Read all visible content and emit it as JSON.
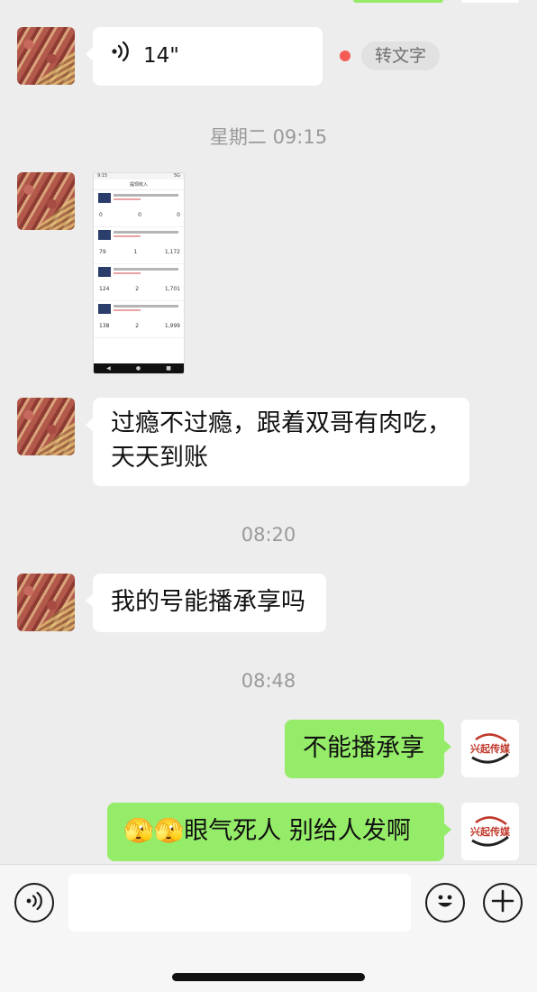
{
  "messages": {
    "voice": {
      "duration": "14\"",
      "convert_label": "转文字"
    },
    "time1": "星期二 09:15",
    "thumbnail": {
      "title": "提现收入",
      "status_left": "9:15",
      "status_right": "5G",
      "rows": [
        {
          "values": [
            "0",
            "0",
            "0"
          ]
        },
        {
          "values": [
            "79",
            "1",
            "1,172"
          ]
        },
        {
          "values": [
            "124",
            "2",
            "1,701"
          ]
        },
        {
          "values": [
            "138",
            "2",
            "1,999"
          ]
        }
      ]
    },
    "text1": "过瘾不过瘾，跟着双哥有肉吃，",
    "text1b": "天天到账",
    "time2": "08:20",
    "text2": "我的号能播承享吗",
    "time3": "08:48",
    "reply1": "不能播承享",
    "reply2_emoji": "🫣🫣",
    "reply2_text": "眼气死人  别给人发啊"
  },
  "brand_logo_text": "兴起传媒",
  "icons": {
    "voice_input": "voice-wave-icon",
    "emoji": "emoji-face-icon",
    "add": "plus-icon"
  },
  "colors": {
    "background": "#ededed",
    "sent_bubble": "#95ec69",
    "received_bubble": "#ffffff",
    "unread_dot": "#f25c54"
  }
}
